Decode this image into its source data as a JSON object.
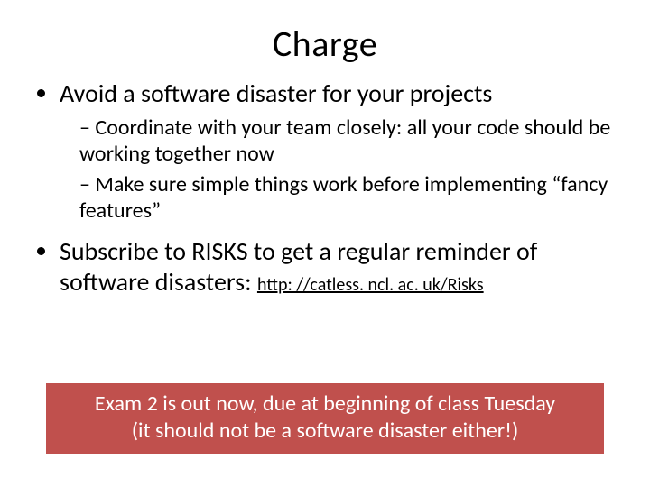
{
  "title": "Charge",
  "bullets": {
    "item1": {
      "text": "Avoid a software disaster for your projects",
      "sub1": "Coordinate with your team closely: all your code should be working together now",
      "sub2": "Make sure simple things work before implementing “fancy features”"
    },
    "item2": {
      "text": "Subscribe to RISKS to get a regular reminder of software disasters: ",
      "link_text": "http: //catless. ncl. ac. uk/Risks",
      "link_href": "http://catless.ncl.ac.uk/Risks"
    }
  },
  "callout": {
    "line1": "Exam 2 is out now, due at beginning of class Tuesday",
    "line2": "(it should not be a software disaster either!)"
  },
  "colors": {
    "callout_bg": "#c0504d",
    "callout_fg": "#ffffff"
  }
}
